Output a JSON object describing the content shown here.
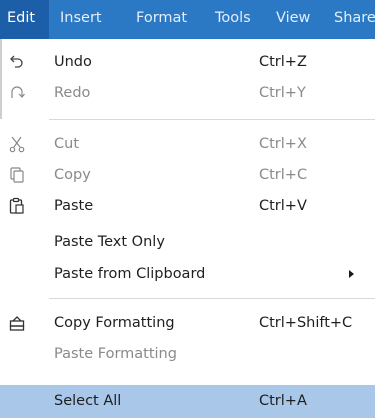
{
  "menubar": {
    "items": [
      {
        "label": "Edit"
      },
      {
        "label": "Insert"
      },
      {
        "label": "Format"
      },
      {
        "label": "Tools"
      },
      {
        "label": "View"
      },
      {
        "label": "Share"
      }
    ]
  },
  "menu": {
    "items": [
      {
        "label": "Undo",
        "shortcut": "Ctrl+Z",
        "icon": "undo-icon"
      },
      {
        "label": "Redo",
        "shortcut": "Ctrl+Y",
        "icon": "redo-icon"
      },
      {
        "label": "Cut",
        "shortcut": "Ctrl+X",
        "icon": "cut-icon"
      },
      {
        "label": "Copy",
        "shortcut": "Ctrl+C",
        "icon": "copy-icon"
      },
      {
        "label": "Paste",
        "shortcut": "Ctrl+V",
        "icon": "paste-icon"
      },
      {
        "label": "Paste Text Only"
      },
      {
        "label": "Paste from Clipboard",
        "submenu_icon": "submenu-arrow-icon"
      },
      {
        "label": "Copy Formatting",
        "shortcut": "Ctrl+Shift+C",
        "icon": "paint-bucket-icon"
      },
      {
        "label": "Paste Formatting"
      },
      {
        "label": "Select All",
        "shortcut": "Ctrl+A"
      }
    ]
  },
  "colors": {
    "menubar_bg": "#2b78c5",
    "menubar_active_bg": "#1d5ea8",
    "highlight_bg": "#a9c7e8",
    "disabled_text": "#8a8a8a"
  }
}
